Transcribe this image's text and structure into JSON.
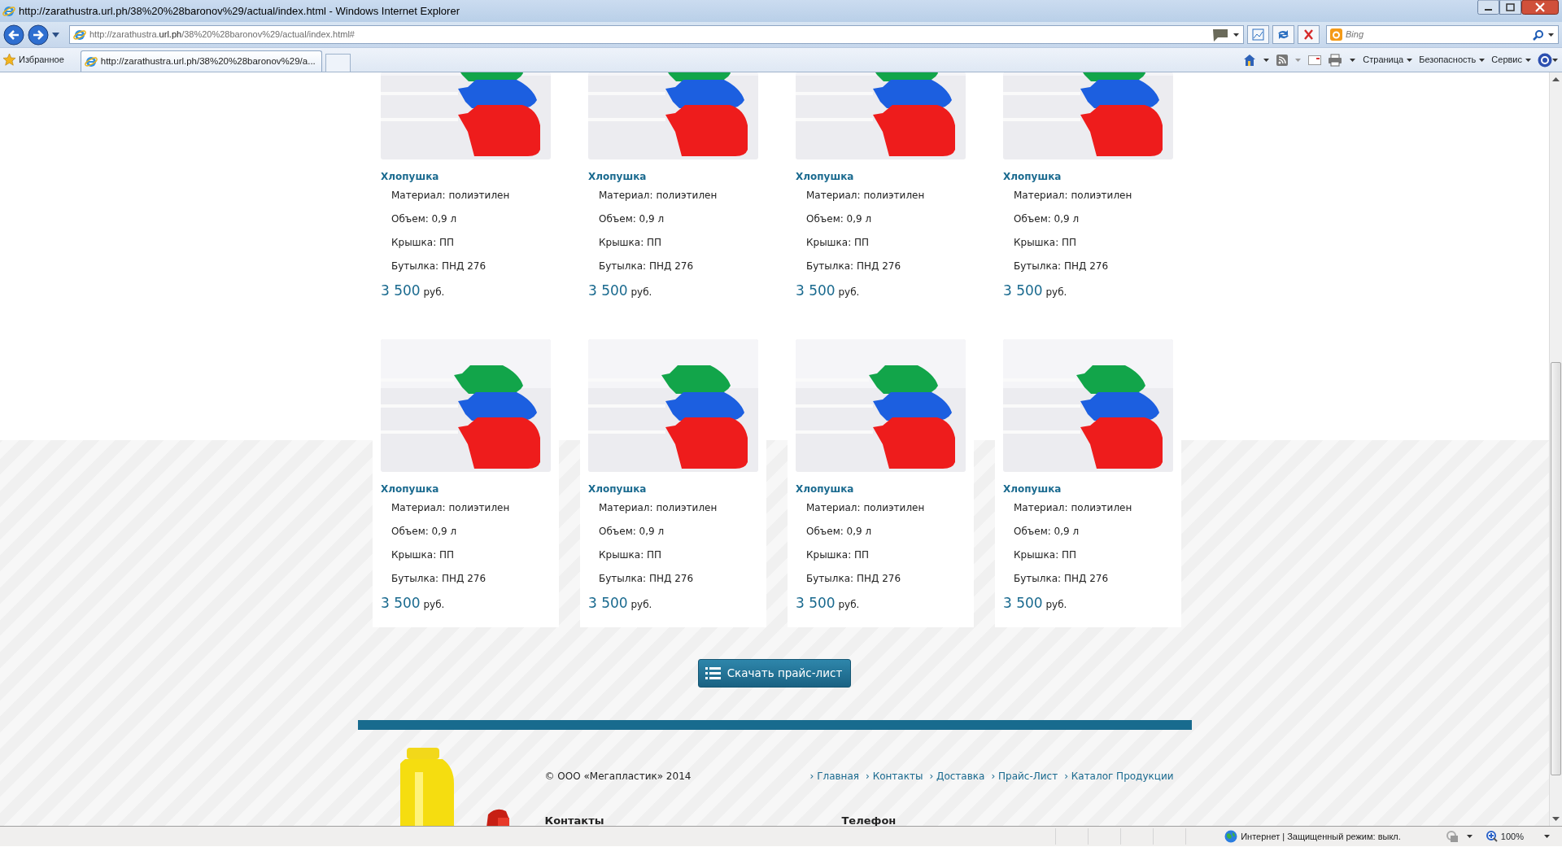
{
  "window": {
    "title": "http://zarathustra.url.ph/38%20%28baronov%29/actual/index.html - Windows Internet Explorer"
  },
  "address_bar": {
    "url_prefix": "http://zarathustra.",
    "url_domain": "url.ph",
    "url_path": "/38%20%28baronov%29/actual/index.html#"
  },
  "search": {
    "placeholder": "Bing"
  },
  "favorites": {
    "label": "Избранное"
  },
  "tabs": [
    {
      "label": "http://zarathustra.url.ph/38%20%28baronov%29/a...",
      "selected": true
    }
  ],
  "command_bar": [
    "Страница",
    "Безопасность",
    "Сервис"
  ],
  "products": [
    {
      "title": "Хлопушка",
      "specs": [
        "Материал: полиэтилен",
        "Объем: 0,9 л",
        "Крышка: ПП",
        "Бутылка: ПНД 276"
      ],
      "price": "3 500",
      "currency": "руб."
    },
    {
      "title": "Хлопушка",
      "specs": [
        "Материал: полиэтилен",
        "Объем: 0,9 л",
        "Крышка: ПП",
        "Бутылка: ПНД 276"
      ],
      "price": "3 500",
      "currency": "руб."
    },
    {
      "title": "Хлопушка",
      "specs": [
        "Материал: полиэтилен",
        "Объем: 0,9 л",
        "Крышка: ПП",
        "Бутылка: ПНД 276"
      ],
      "price": "3 500",
      "currency": "руб."
    },
    {
      "title": "Хлопушка",
      "specs": [
        "Материал: полиэтилен",
        "Объем: 0,9 л",
        "Крышка: ПП",
        "Бутылка: ПНД 276"
      ],
      "price": "3 500",
      "currency": "руб."
    },
    {
      "title": "Хлопушка",
      "specs": [
        "Материал: полиэтилен",
        "Объем: 0,9 л",
        "Крышка: ПП",
        "Бутылка: ПНД 276"
      ],
      "price": "3 500",
      "currency": "руб."
    },
    {
      "title": "Хлопушка",
      "specs": [
        "Материал: полиэтилен",
        "Объем: 0,9 л",
        "Крышка: ПП",
        "Бутылка: ПНД 276"
      ],
      "price": "3 500",
      "currency": "руб."
    },
    {
      "title": "Хлопушка",
      "specs": [
        "Материал: полиэтилен",
        "Объем: 0,9 л",
        "Крышка: ПП",
        "Бутылка: ПНД 276"
      ],
      "price": "3 500",
      "currency": "руб."
    },
    {
      "title": "Хлопушка",
      "specs": [
        "Материал: полиэтилен",
        "Объем: 0,9 л",
        "Крышка: ПП",
        "Бутылка: ПНД 276"
      ],
      "price": "3 500",
      "currency": "руб."
    }
  ],
  "download_button": {
    "label": "Скачать прайс-лист"
  },
  "footer": {
    "copyright": "© ООО «Мегапластик» 2014",
    "links": [
      "› Главная",
      "› Контакты",
      "› Доставка",
      "› Прайс-Лист",
      "› Каталог Продукции"
    ],
    "headings": [
      "Контакты",
      "Телефон"
    ]
  },
  "status_bar": {
    "zone": "Интернет | Защищенный режим: выкл.",
    "zoom": "100%"
  }
}
